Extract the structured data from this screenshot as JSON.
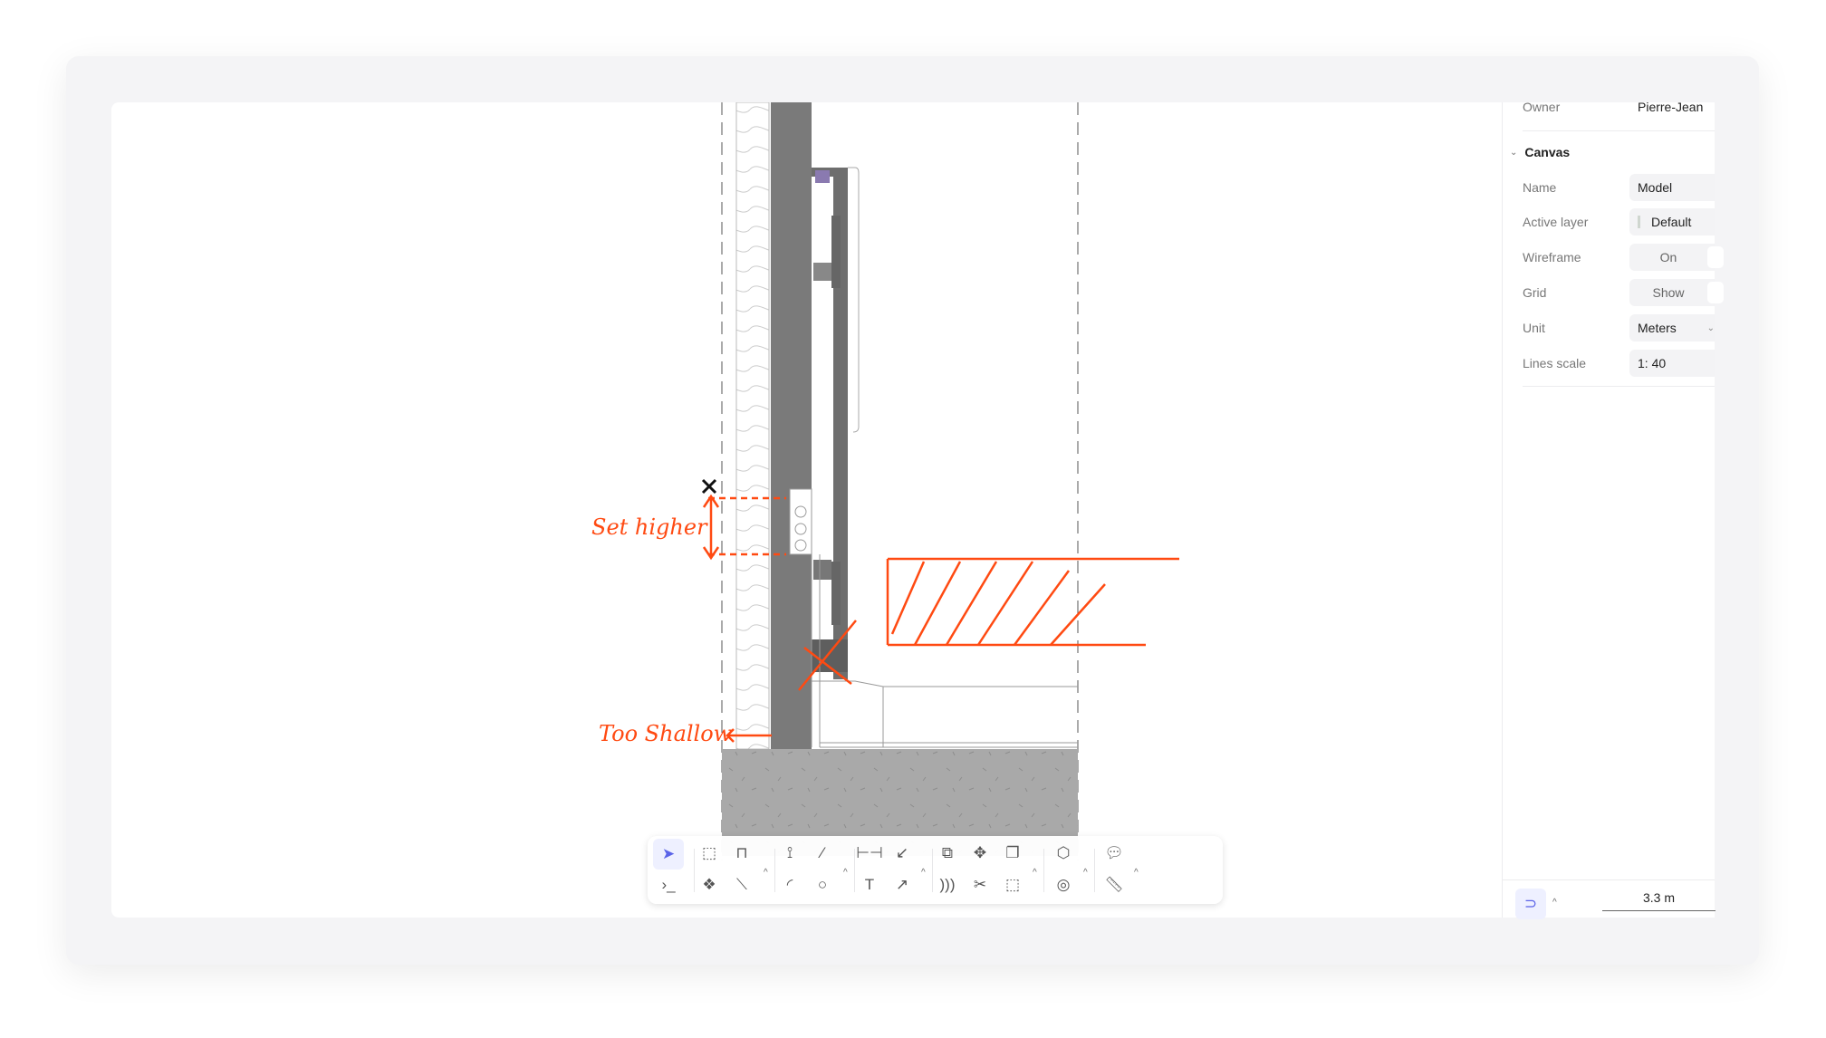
{
  "properties": {
    "owner_label": "Owner",
    "owner_value": "Pierre-Jean",
    "section_title": "Canvas",
    "rows": [
      {
        "label": "Name",
        "value": "Model"
      },
      {
        "label": "Active layer",
        "value": "Default"
      },
      {
        "label": "Wireframe",
        "value": "On"
      },
      {
        "label": "Grid",
        "value": "Show"
      },
      {
        "label": "Unit",
        "value": "Meters"
      },
      {
        "label": "Lines scale",
        "value": "1: 40"
      }
    ]
  },
  "annotations": {
    "set_higher": "Set higher",
    "too_shallow": "Too Shallow"
  },
  "scale_bar": {
    "value": "3.3 m"
  },
  "colors": {
    "markup": "#ff4a12",
    "accent": "#5a63e8",
    "wall": "#7a7a7a",
    "slab": "#a8a8a8"
  },
  "toolbar": {
    "icons": [
      "select-arrow",
      "cube",
      "door",
      "polyline",
      "line",
      "dimension",
      "label-leader",
      "copy",
      "move",
      "duplicate",
      "add-3d-object",
      "comment",
      "terminal",
      "component",
      "measure-line",
      "arc",
      "circle",
      "text",
      "arrow",
      "offset",
      "scissors",
      "crop",
      "camera-view",
      "ruler"
    ]
  },
  "snap": {
    "icon": "magnet"
  }
}
